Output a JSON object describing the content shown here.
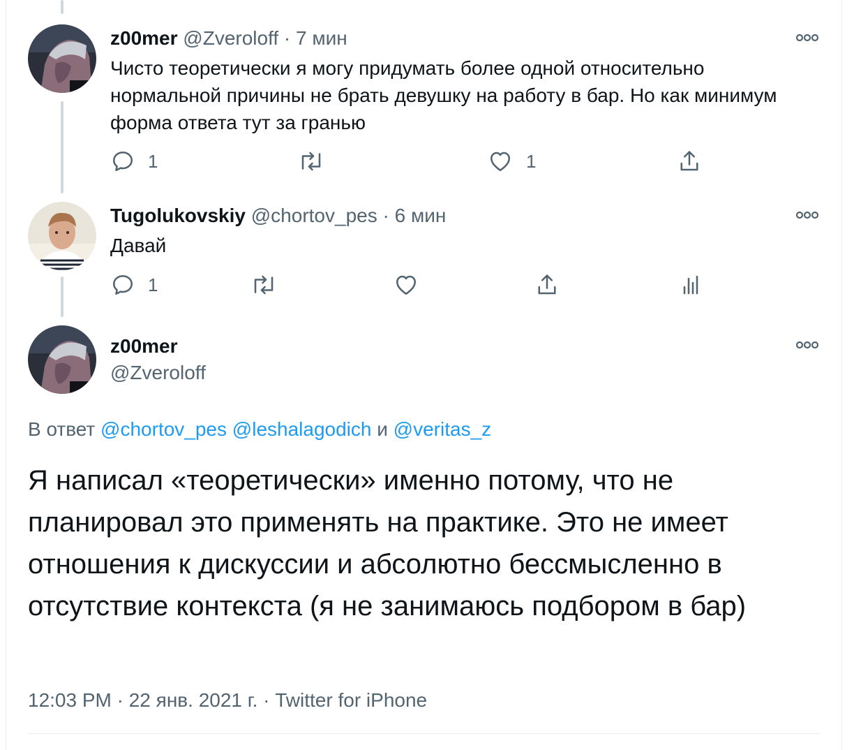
{
  "tweets": [
    {
      "name": "z00mer",
      "handle": "@Zveroloff",
      "time": "· 7 мин",
      "text": "Чисто теоретически я могу придумать более одной относительно нормальной причины не брать девушку на работу в бар. Но как минимум форма ответа тут за гранью",
      "actions": {
        "reply_count": "1",
        "retweet_count": "",
        "like_count": "1"
      }
    },
    {
      "name": "Tugolukovskiy",
      "handle": "@chortov_pes",
      "time": "· 6 мин",
      "text": "Давай",
      "actions": {
        "reply_count": "1",
        "retweet_count": "",
        "like_count": ""
      }
    }
  ],
  "main_tweet": {
    "name": "z00mer",
    "handle": "@Zveroloff",
    "reply_prefix": "В ответ ",
    "reply_handles": [
      "@chortov_pes",
      "@leshalagodich",
      "@veritas_z"
    ],
    "reply_joiner": " и ",
    "text": "Я написал «теоретически» именно потому, что не планировал это применять на практике. Это не имеет отношения к дискуссии и абсолютно бессмысленно в отсутствие контекста (я не занимаюсь подбором в бар)",
    "timestamp": "12:03 PM · 22 янв. 2021 г. · Twitter for iPhone"
  },
  "icons": {
    "reply": "reply-icon",
    "retweet": "retweet-icon",
    "like": "heart-icon",
    "share": "share-icon",
    "analytics": "analytics-icon",
    "more": "more-icon"
  },
  "colors": {
    "text": "#0f1419",
    "secondary": "#536471",
    "link": "#1d9bf0",
    "thread_line": "#cfd9de"
  }
}
